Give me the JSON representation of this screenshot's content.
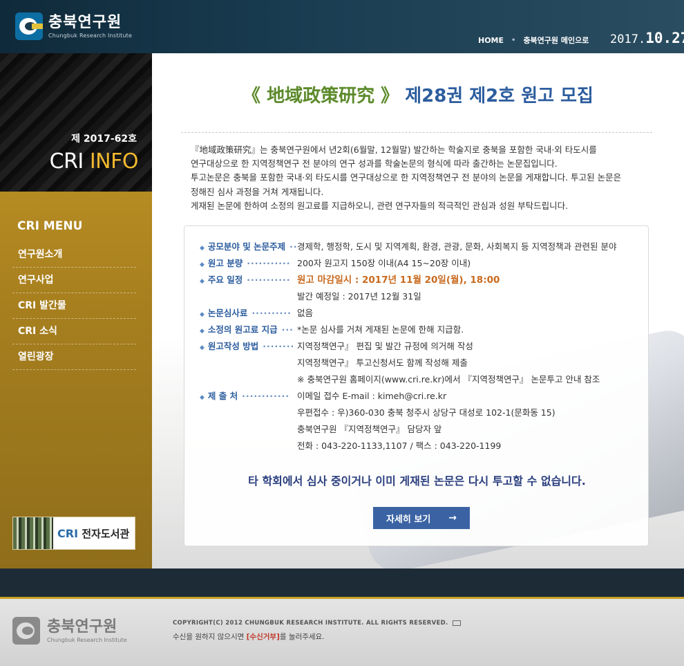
{
  "header": {
    "logo_ko": "충북연구원",
    "logo_en": "Chungbuk Research Institute",
    "nav": [
      {
        "label": "HOME"
      },
      {
        "label": "충북연구원 메인으로"
      }
    ],
    "date_year": "2017.",
    "date_md": "10.27."
  },
  "sidebar": {
    "issue": "제 2017-62호",
    "info_cri": "CRI",
    "info_word": "INFO",
    "menu_title": "CRI MENU",
    "menu": [
      "연구원소개",
      "연구사업",
      "CRI 발간물",
      "CRI 소식",
      "열린광장"
    ],
    "library_cri": "CRI",
    "library_label": "전자도서관"
  },
  "main": {
    "title_journal": "《 地域政策研究 》",
    "title_rest": "제28권 제2호 원고 모집",
    "intro": [
      "『地域政策研究』는 충북연구원에서 년2회(6월말, 12월말) 발간하는 학술지로 충북을 포함한 국내·외 타도시를",
      "연구대상으로 한 지역정책연구 전 분야의 연구 성과를 학술논문의 형식에 따라 출간하는 논문집입니다.",
      "투고논문은 충북을 포함한 국내·외 타도시를 연구대상으로 한 지역정책연구 전 분야의 논문을 게재합니다. 투고된 논문은",
      "정해진 심사 과정을 거쳐 게재됩니다.",
      "게재된 논문에 한하여 소정의 원고료를 지급하오니, 관련 연구자들의 적극적인 관심과 성원 부탁드립니다."
    ],
    "details": [
      {
        "label": "공모분야 및 논문주제",
        "dots": "··",
        "value": "경제학, 행정학, 도시 및 지역계획, 환경, 관광, 문화,  사회복지 등 지역정책과 관련된 분야"
      },
      {
        "label": "원고 분량",
        "dots": "···········",
        "value": "200자 원고지 150장 이내(A4 15~20장 이내)"
      },
      {
        "label": "주요 일정",
        "dots": "···········",
        "value": "원고 마감일시 : 2017년 11월 20일(월), 18:00",
        "highlight": true
      },
      {
        "label": "",
        "dots": "",
        "value": "발간 예정일 : 2017년 12월 31일"
      },
      {
        "label": "논문심사료",
        "dots": "··········",
        "value": "없음"
      },
      {
        "label": "소정의 원고료 지급",
        "dots": "···",
        "value": "*논문 심사를 거쳐 게재된 논문에 한해 지급함."
      },
      {
        "label": "원고작성 방법",
        "dots": "········",
        "value": "지역정책연구』 편집 및 발간 규정에 의거해 작성"
      },
      {
        "label": "",
        "dots": "",
        "value": "지역정책연구』 투고신청서도 함께 작성해 제출"
      },
      {
        "label": "",
        "dots": "",
        "value": "※ 충북연구원 홈페이지(www.cri.re.kr)에서  『지역정책연구』 논문투고 안내 참조"
      },
      {
        "label": "제 출 처",
        "dots": "············",
        "value": "이메일 접수 E-mail : kimeh@cri.re.kr"
      },
      {
        "label": "",
        "dots": "",
        "value": "우편접수 : 우)360-030 충북 청주시 상당구 대성로 102-1(문화동 15)"
      },
      {
        "label": "",
        "dots": "",
        "value": "충북연구원  『지역정책연구』 담당자 앞"
      },
      {
        "label": "",
        "dots": "",
        "value": " 전화 : 043-220-1133,1107 / 팩스 : 043-220-1199"
      }
    ],
    "notice": "타 학회에서 심사 중이거나 이미 게재된 논문은 다시 투고할 수 없습니다.",
    "more_button": "자세히 보기",
    "more_arrow": "→"
  },
  "footer": {
    "logo_ko": "충북연구원",
    "logo_en": "Chungbuk Research Institute",
    "copyright": "COPYRIGHT(C) 2012 CHUNGBUK RESEARCH INSTITUTE.  ALL RIGHTS RESERVED.",
    "unsub_pre": "수신을 원하지 않으시면 ",
    "unsub_link": "[수신거부]",
    "unsub_post": "를 눌러주세요."
  },
  "colors": {
    "brand_blue": "#2c5d9e",
    "journal_green": "#5c8a2b",
    "sidebar_gold": "#b58b23",
    "deadline_orange": "#c86a1e"
  }
}
